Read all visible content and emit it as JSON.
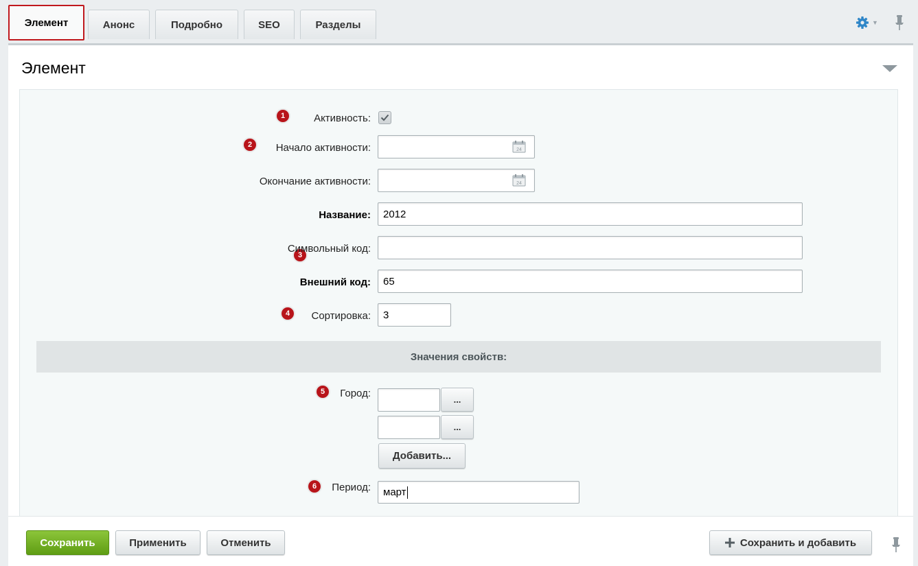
{
  "tabs": [
    {
      "label": "Элемент",
      "active": true
    },
    {
      "label": "Анонс",
      "active": false
    },
    {
      "label": "Подробно",
      "active": false
    },
    {
      "label": "SEO",
      "active": false
    },
    {
      "label": "Разделы",
      "active": false
    }
  ],
  "panel": {
    "title": "Элемент"
  },
  "fields": {
    "active": {
      "badge": "1",
      "label": "Активность:",
      "checked": true
    },
    "active_from": {
      "badge": "2",
      "label": "Начало активности:",
      "value": ""
    },
    "active_to": {
      "label": "Окончание активности:",
      "value": ""
    },
    "name": {
      "badge": "3",
      "label": "Название:",
      "value": "2012"
    },
    "code": {
      "label": "Символьный код:",
      "value": ""
    },
    "xml_id": {
      "label": "Внешний код:",
      "value": "65"
    },
    "sort": {
      "badge": "4",
      "label": "Сортировка:",
      "value": "3"
    }
  },
  "properties": {
    "section_title": "Значения свойств:",
    "city": {
      "badge": "5",
      "label": "Город:",
      "values": [
        "",
        ""
      ],
      "browse_label": "...",
      "add_label": "Добавить..."
    },
    "period": {
      "badge": "6",
      "label": "Период:",
      "value": "март"
    }
  },
  "footer": {
    "save": "Сохранить",
    "apply": "Применить",
    "cancel": "Отменить",
    "save_and_add": "Сохранить и добавить"
  },
  "colors": {
    "accent_green": "#6aa81c",
    "badge_red": "#b8141a",
    "active_tab_border": "#c0181d"
  },
  "icons": {
    "settings": "gear-icon",
    "pin": "pin-icon",
    "calendar": "calendar-icon",
    "collapse": "triangle-down-icon",
    "plus": "plus-icon"
  }
}
